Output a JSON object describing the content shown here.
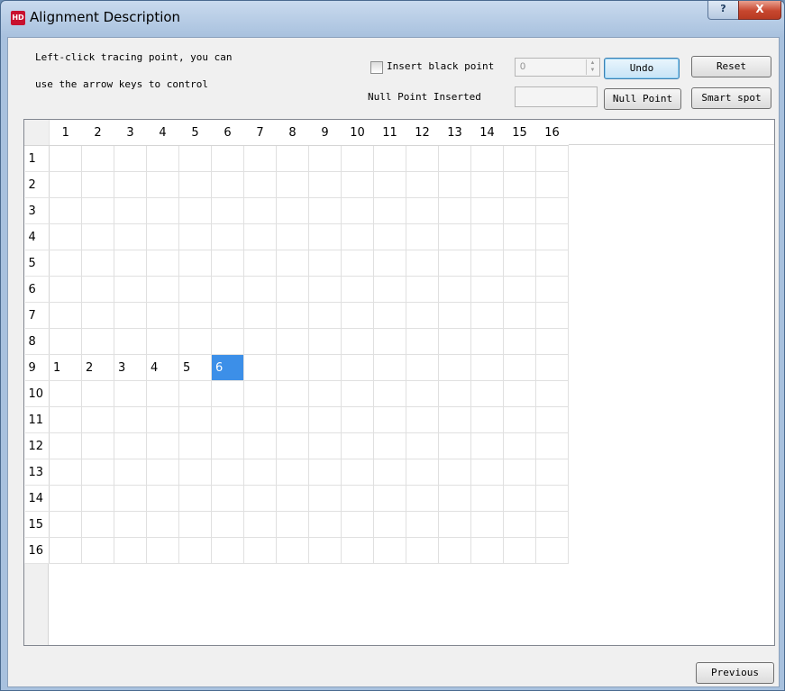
{
  "window": {
    "title": "Alignment Description",
    "app_icon": "HD",
    "help_icon": "?",
    "close_icon": "X"
  },
  "instructions": {
    "line1": "Left-click tracing point, you can",
    "line2": "use the arrow keys to control"
  },
  "insert_black_point": {
    "label": "Insert black point",
    "checked": false,
    "value": "0"
  },
  "null_point_inserted": {
    "label": "Null Point Inserted",
    "value": ""
  },
  "buttons": {
    "undo": "Undo",
    "reset": "Reset",
    "null_point": "Null Point",
    "smart_spot": "Smart spot",
    "previous": "Previous"
  },
  "grid": {
    "columns": [
      "1",
      "2",
      "3",
      "4",
      "5",
      "6",
      "7",
      "8",
      "9",
      "10",
      "11",
      "12",
      "13",
      "14",
      "15",
      "16"
    ],
    "rows": [
      "1",
      "2",
      "3",
      "4",
      "5",
      "6",
      "7",
      "8",
      "9",
      "10",
      "11",
      "12",
      "13",
      "14",
      "15",
      "16"
    ],
    "bold_column": "6",
    "bold_row": "9",
    "cells": [
      {
        "row": "9",
        "col": "1",
        "value": "1"
      },
      {
        "row": "9",
        "col": "2",
        "value": "2"
      },
      {
        "row": "9",
        "col": "3",
        "value": "3"
      },
      {
        "row": "9",
        "col": "4",
        "value": "4"
      },
      {
        "row": "9",
        "col": "5",
        "value": "5"
      },
      {
        "row": "9",
        "col": "6",
        "value": "6",
        "selected": true
      }
    ],
    "selection_color": "#3c8fe8"
  }
}
